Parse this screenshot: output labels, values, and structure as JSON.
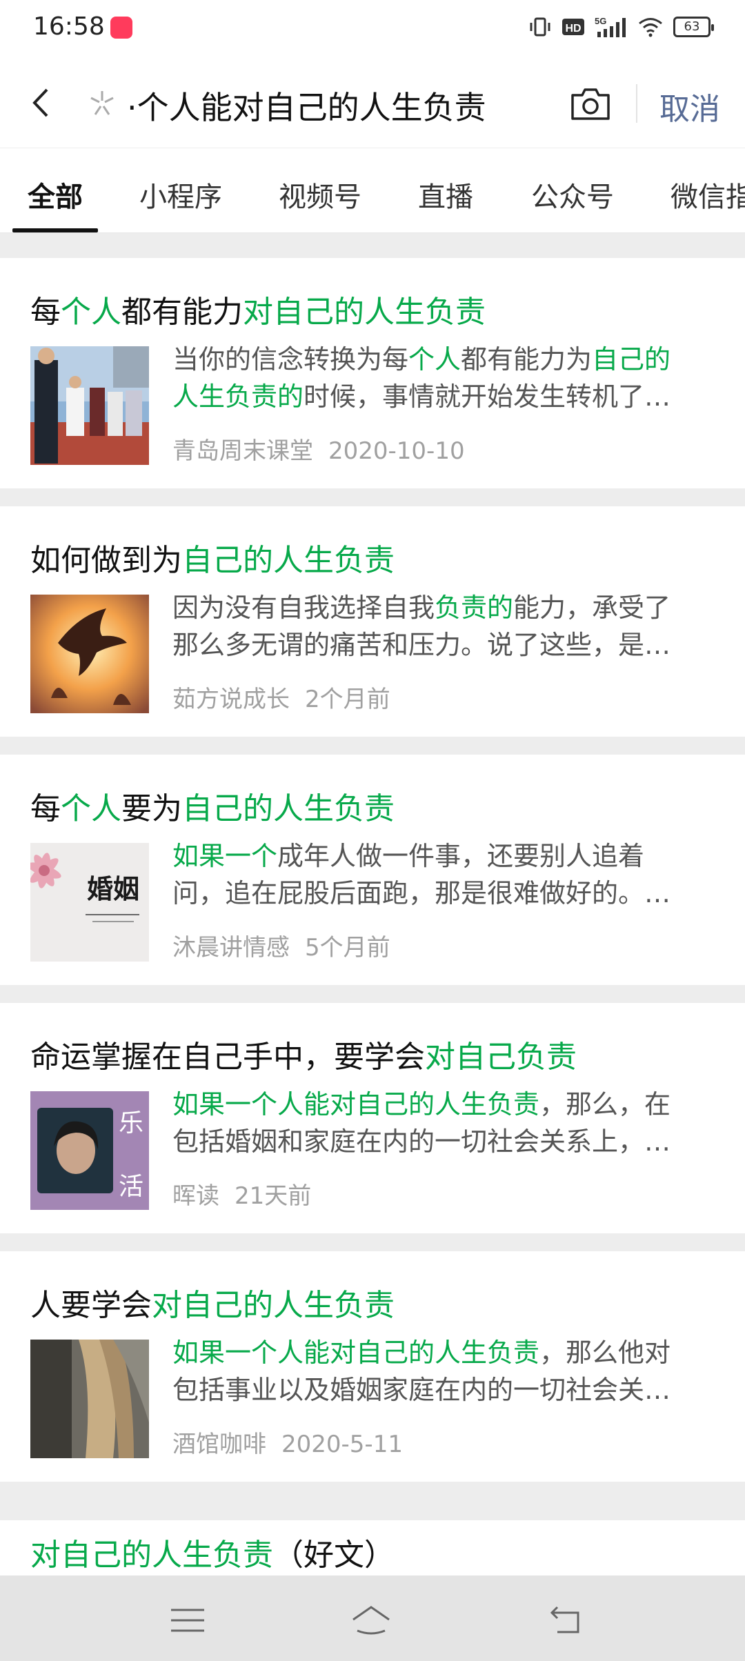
{
  "status": {
    "time": "16:58",
    "battery": "63",
    "network": "5G",
    "hd": "HD"
  },
  "search": {
    "query": "·个人能对自己的人生负责",
    "cancel_label": "取消"
  },
  "tabs": [
    {
      "label": "全部",
      "active": true
    },
    {
      "label": "小程序"
    },
    {
      "label": "视频号"
    },
    {
      "label": "直播"
    },
    {
      "label": "公众号"
    },
    {
      "label": "微信指"
    }
  ],
  "results": [
    {
      "title_parts": [
        {
          "t": "每",
          "hl": false
        },
        {
          "t": "个人",
          "hl": true
        },
        {
          "t": "都有能力",
          "hl": false
        },
        {
          "t": "对自己的人生负责",
          "hl": true
        }
      ],
      "snippet_line1_parts": [
        {
          "t": "当你的信念转换为每",
          "hl": false
        },
        {
          "t": "个人",
          "hl": true
        },
        {
          "t": "都有能力为",
          "hl": false
        },
        {
          "t": "自己的",
          "hl": true
        }
      ],
      "snippet_line2_parts": [
        {
          "t": "人生负责的",
          "hl": true
        },
        {
          "t": "时候，事情就开始发生转机了…",
          "hl": false
        }
      ],
      "source": "青岛周末课堂",
      "date": "2020-10-10",
      "thumb": "group-photo-outdoor"
    },
    {
      "title_parts": [
        {
          "t": "如何做到为",
          "hl": false
        },
        {
          "t": "自己的人生负责",
          "hl": true
        }
      ],
      "snippet_line1_parts": [
        {
          "t": "因为没有自我选择自我",
          "hl": false
        },
        {
          "t": "负责的",
          "hl": true
        },
        {
          "t": "能力，承受了",
          "hl": false
        }
      ],
      "snippet_line2_parts": [
        {
          "t": "那么多无谓的痛苦和压力。说了这些，是…",
          "hl": false
        }
      ],
      "source": "茹方说成长",
      "date": "2个月前",
      "thumb": "bird-sunset"
    },
    {
      "title_parts": [
        {
          "t": "每",
          "hl": false
        },
        {
          "t": "个人",
          "hl": true
        },
        {
          "t": "要为",
          "hl": false
        },
        {
          "t": "自己的人生负责",
          "hl": true
        }
      ],
      "snippet_line1_parts": [
        {
          "t": "如果一个",
          "hl": true
        },
        {
          "t": "成年人做一件事，还要别人追着",
          "hl": false
        }
      ],
      "snippet_line2_parts": [
        {
          "t": "问，追在屁股后面跑，那是很难做好的。…",
          "hl": false
        }
      ],
      "source": "沐晨讲情感",
      "date": "5个月前",
      "thumb": "marriage-flower",
      "thumb_text": "婚姻"
    },
    {
      "title_parts": [
        {
          "t": "命运掌握在自己手中，要学会",
          "hl": false
        },
        {
          "t": "对自己负责",
          "hl": true
        }
      ],
      "snippet_line1_parts": [
        {
          "t": "如果一个人能对自己的人生负责",
          "hl": true
        },
        {
          "t": "，那么，在",
          "hl": false
        }
      ],
      "snippet_line2_parts": [
        {
          "t": "包括婚姻和家庭在内的一切社会关系上，…",
          "hl": false
        }
      ],
      "source": "晖读",
      "date": "21天前",
      "thumb": "portrait-purple",
      "thumb_text_1": "乐",
      "thumb_text_2": "活"
    },
    {
      "title_parts": [
        {
          "t": "人要学会",
          "hl": false
        },
        {
          "t": "对自己的人生负责",
          "hl": true
        }
      ],
      "snippet_line1_parts": [
        {
          "t": "如果一个人能对自己的人生负责",
          "hl": true
        },
        {
          "t": "，那么他对",
          "hl": false
        }
      ],
      "snippet_line2_parts": [
        {
          "t": "包括事业以及婚姻家庭在内的一切社会关…",
          "hl": false
        }
      ],
      "source": "酒馆咖啡",
      "date": "2020-5-11",
      "thumb": "hair-closeup"
    }
  ],
  "last_result": {
    "title_parts": [
      {
        "t": "对自己的人生负责",
        "hl": true
      },
      {
        "t": "（好文）",
        "hl": false
      }
    ]
  },
  "colors": {
    "highlight": "#07a94a",
    "cancel": "#576b95",
    "meta": "#a0a0a0"
  }
}
